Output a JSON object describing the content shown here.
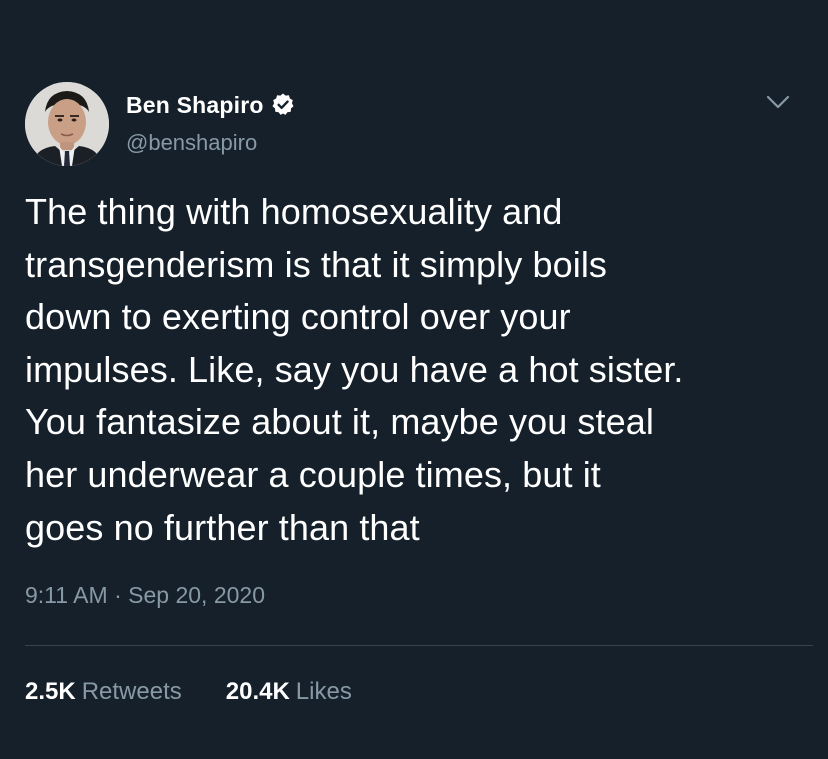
{
  "tweet": {
    "author": {
      "display_name": "Ben Shapiro",
      "handle": "@benshapiro",
      "verified": true
    },
    "text_lines": [
      "The thing with homosexuality and",
      "transgenderism is that it simply boils",
      "down to exerting control over your",
      "impulses. Like, say you have a hot sister.",
      "You fantasize about it, maybe you steal",
      "her underwear a couple times, but it",
      "goes no further than that"
    ],
    "time": "9:11 AM",
    "separator": "·",
    "date": "Sep 20, 2020",
    "retweets": {
      "count": "2.5K",
      "label": "Retweets"
    },
    "likes": {
      "count": "20.4K",
      "label": "Likes"
    }
  },
  "icons": {
    "verified": "verified-badge-icon",
    "menu": "chevron-down-icon"
  },
  "colors": {
    "background": "#15202b",
    "text_primary": "#ffffff",
    "text_secondary": "#8899a6",
    "divider": "#38444d"
  }
}
